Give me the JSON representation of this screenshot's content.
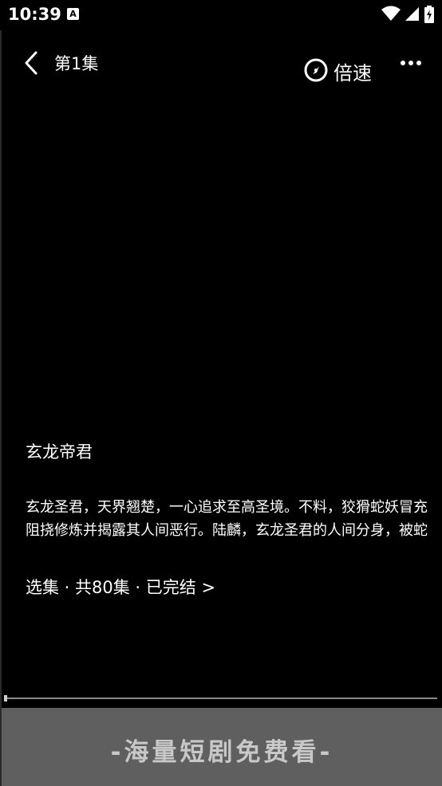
{
  "status_bar": {
    "time": "10:39",
    "app_notification_letter": "A",
    "icons": [
      "wifi-icon",
      "cell-signal-icon",
      "battery-charging-icon"
    ]
  },
  "top_bar": {
    "back_icon": "chevron-left-icon",
    "episode_title": "第1集",
    "speed_icon": "speed-dial-icon",
    "speed_label": "倍速",
    "more_icon": "more-dots-icon"
  },
  "show": {
    "title": "玄龙帝君",
    "description_line1": "玄龙圣君，天界翘楚，一心追求至高圣境。不料，狡猾蛇妖冒充",
    "description_line2": "阻挠修炼并揭露其人间恶行。陆麟，玄龙圣君的人间分身，被蛇",
    "episodes_label": "选集 · 共80集 · 已完结 >"
  },
  "player": {
    "progress_fraction": 0.0
  },
  "banner": {
    "text": "-海量短剧免费看-"
  },
  "colors": {
    "background": "#000000",
    "banner": "#5f5f5f",
    "banner_text": "#c8c8c8"
  }
}
